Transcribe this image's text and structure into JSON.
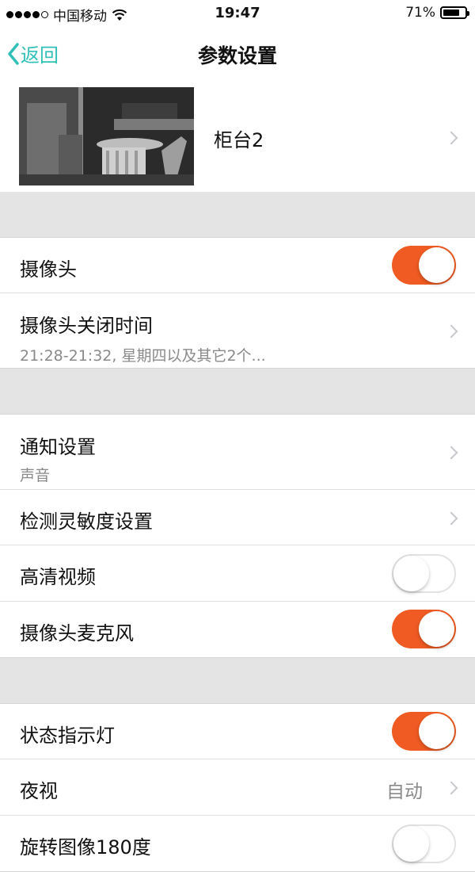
{
  "status_bar": {
    "carrier": "中国移动",
    "time": "19:47",
    "battery_percent": "71%",
    "battery_level": 0.71,
    "signal_filled": 4,
    "signal_total": 5
  },
  "nav": {
    "back_label": "返回",
    "title": "参数设置",
    "accent_color": "#30c0b8"
  },
  "device": {
    "name": "柜台2"
  },
  "toggle_on_color": "#ef5b22",
  "sections": {
    "s1": {
      "camera": {
        "label": "摄像头",
        "on": true
      },
      "camera_off_time": {
        "label": "摄像头关闭时间",
        "sub": "21:28-21:32, 星期四以及其它2个..."
      }
    },
    "s2": {
      "notification": {
        "label": "通知设置",
        "sub": "声音"
      },
      "sensitivity": {
        "label": "检测灵敏度设置"
      },
      "hd_video": {
        "label": "高清视频",
        "on": false
      },
      "camera_mic": {
        "label": "摄像头麦克风",
        "on": true
      }
    },
    "s3": {
      "status_light": {
        "label": "状态指示灯",
        "on": true
      },
      "night_vision": {
        "label": "夜视",
        "value": "自动"
      },
      "rotate": {
        "label": "旋转图像180度",
        "on": false
      }
    }
  }
}
